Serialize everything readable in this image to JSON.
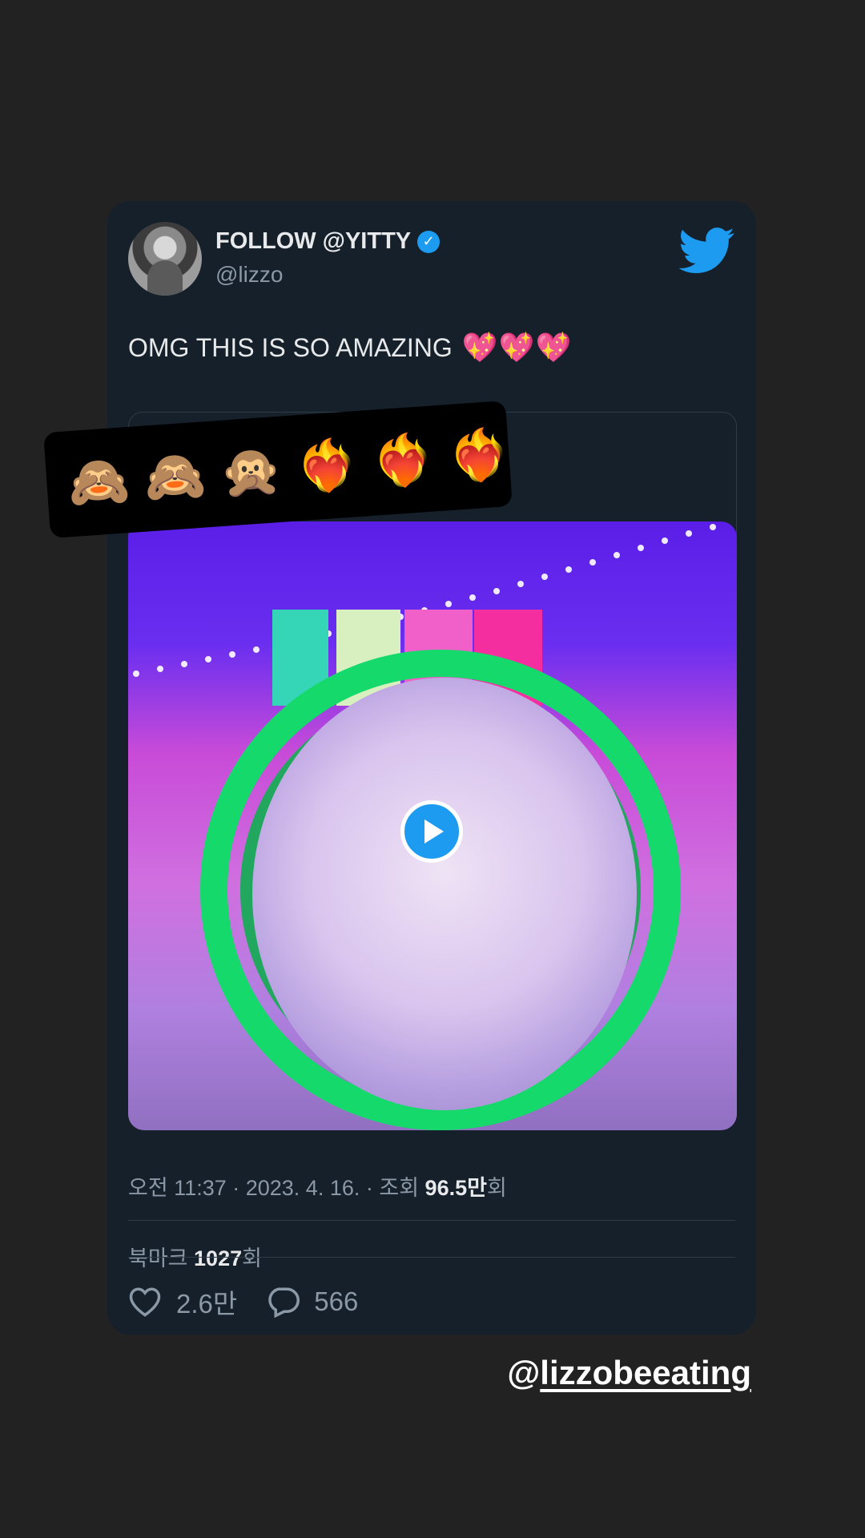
{
  "tweet": {
    "display_name": "FOLLOW @YITTY",
    "verified_mark": "✓",
    "handle": "@lizzo",
    "text": "OMG THIS IS SO AMAZING",
    "text_emoji": [
      "💖",
      "💖",
      "💖"
    ],
    "meta": {
      "prefix": "오전 11:37 · 2023. 4. 16. · 조회 ",
      "views": "96.5만",
      "suffix": "회"
    },
    "bookmark": {
      "prefix": "북마크 ",
      "count": "1027",
      "suffix": "회"
    },
    "likes": "2.6만",
    "replies": "566"
  },
  "sticker_emoji": [
    "🙈",
    "🙈",
    "🙊",
    "❤️‍🔥",
    "❤️‍🔥",
    "❤️‍🔥"
  ],
  "mention": {
    "at": "@",
    "username": "lizzobeeating"
  },
  "colors": {
    "background": "#222222",
    "card": "#15202b",
    "accent": "#1d9bf0",
    "text": "#e7e9ea",
    "muted": "#8b98a5"
  },
  "icons": [
    "twitter-bird-icon",
    "verified-badge-icon",
    "play-icon",
    "heart-icon",
    "reply-icon"
  ]
}
